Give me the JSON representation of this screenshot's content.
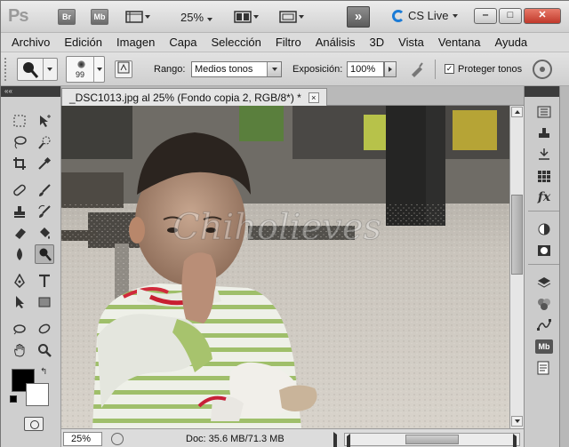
{
  "app": {
    "logo": "Ps",
    "bridge_badge": "Br",
    "minibridge_badge": "Mb",
    "zoom_level": "25%",
    "workspace_more": "»",
    "cs_live": "CS Live",
    "window_buttons": [
      "‒",
      "□",
      "✕"
    ]
  },
  "menubar": {
    "items": [
      "Archivo",
      "Edición",
      "Imagen",
      "Capa",
      "Selección",
      "Filtro",
      "Análisis",
      "3D",
      "Vista",
      "Ventana",
      "Ayuda"
    ]
  },
  "options": {
    "brush_size": "99",
    "range_label": "Rango:",
    "range_value": "Medios tonos",
    "exposure_label": "Exposición:",
    "exposure_value": "100%",
    "protect_checked": "✓",
    "protect_label": "Proteger tonos"
  },
  "document": {
    "tab_title": "_DSC1013.jpg al 25% (Fondo copia 2, RGB/8*) *",
    "tab_close": "×",
    "status_zoom": "25%",
    "doc_info": "Doc: 35.6 MB/71.3 MB",
    "watermark": "Chiholieves"
  },
  "tools": {
    "panel_collapse": "««",
    "icons": [
      "marquee-icon",
      "move-icon",
      "lasso-icon",
      "quick-selection-icon",
      "crop-icon",
      "eyedropper-icon",
      "spot-healing-icon",
      "brush-icon",
      "clone-stamp-icon",
      "history-brush-icon",
      "eraser-icon",
      "paint-bucket-icon",
      "blur-icon",
      "dodge-icon",
      "pen-icon",
      "type-icon",
      "path-selection-icon",
      "rectangle-icon",
      "3d-rotate-icon",
      "3d-orbit-icon",
      "hand-icon",
      "zoom-icon"
    ]
  },
  "right_dock": {
    "icons": [
      "history-icon",
      "clone-source-icon",
      "actions-icon",
      "swatches-icon",
      "styles-icon",
      "adjustments-icon",
      "masks-icon",
      "layers-icon",
      "channels-icon",
      "paths-icon",
      "mini-bridge-icon",
      "notes-icon"
    ],
    "mb_label": "Mb",
    "fx_label": "fx"
  }
}
